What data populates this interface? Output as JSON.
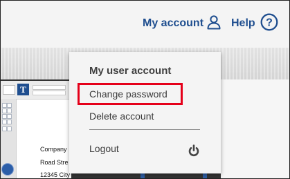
{
  "header": {
    "account_label": "My account",
    "account_icon": "user-icon",
    "help_label": "Help",
    "help_icon": "question-circle-icon"
  },
  "account_menu": {
    "title": "My user account",
    "items": [
      {
        "label": "Change password"
      },
      {
        "label": "Delete account"
      },
      {
        "label": "Logout",
        "icon": "power-icon"
      }
    ]
  },
  "background_editor": {
    "tool_icon": "T",
    "text_lines": [
      "Company",
      "Road Stre",
      "12345 City"
    ]
  },
  "colors": {
    "brand": "#1f4e8f",
    "highlight": "#e5001a",
    "menu_bg": "#f4f4f4"
  }
}
